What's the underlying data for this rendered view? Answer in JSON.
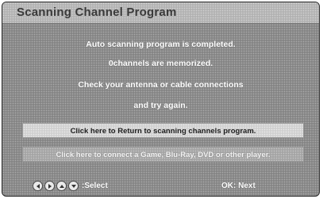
{
  "dialog": {
    "title": "Scanning Channel Program",
    "messages": [
      "Auto scanning program is completed.",
      "0channels are memorized.",
      "Check your antenna or cable connections",
      "and try again."
    ],
    "buttons": {
      "return_label": "Click here to Return to scanning channels program.",
      "connect_label": "Click here to connect a Game, Blu-Ray, DVD or other player."
    }
  },
  "footer": {
    "nav_icons": [
      "left-arrow-icon",
      "right-arrow-icon",
      "up-arrow-icon",
      "down-arrow-icon"
    ],
    "select_label": ":Select",
    "ok_label": "OK: Next"
  },
  "colors": {
    "screen_bg": "#8f8f8f",
    "title_bar": "#b9b9b9",
    "selected_button": "#d6d6d6",
    "unselected_button": "#acacac",
    "text": "#ffffff"
  }
}
